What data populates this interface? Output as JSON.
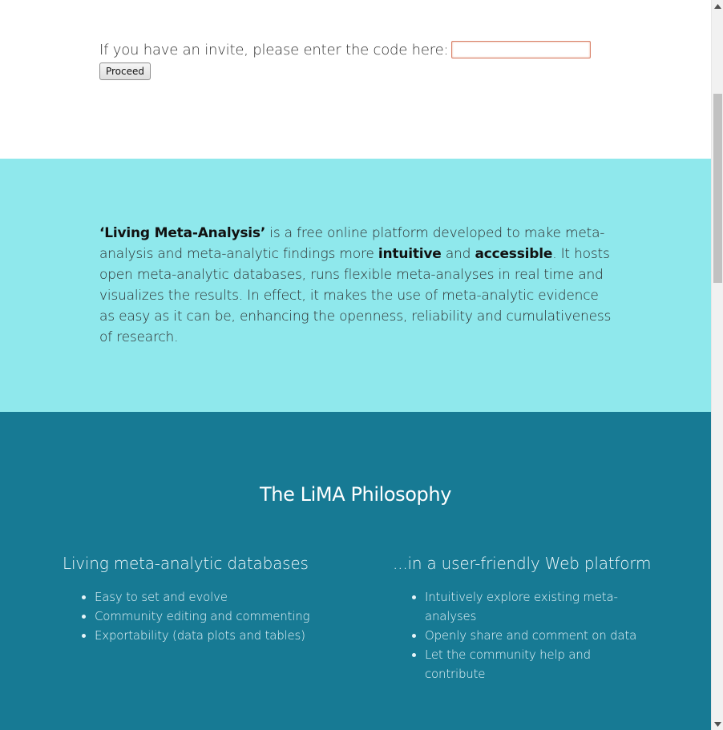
{
  "invite": {
    "label": "If you have an invite, please enter the code here:",
    "input_value": "",
    "proceed_label": "Proceed"
  },
  "intro": {
    "parts": [
      "‘Living Meta-Analysis’",
      " is a free online platform developed to make meta-analysis and meta-analytic findings more ",
      "intuitive",
      " and ",
      "accessible",
      ". It hosts open meta-analytic databases, runs flexible meta-analyses in real time and visualizes the results. In effect, it makes the use of meta-analytic evidence as easy as it can be, enhancing the openness, reliability and cumulativeness of research."
    ]
  },
  "philosophy": {
    "title": "The LiMA Philosophy",
    "left": {
      "heading": "Living meta-analytic databases",
      "items": [
        "Easy to set and evolve",
        "Community editing and commenting",
        "Exportability (data plots and tables)"
      ]
    },
    "right": {
      "heading": "...in a user-friendly Web platform",
      "items": [
        "Intuitively explore existing meta-analyses",
        "Openly share and comment on data",
        "Let the community help and contribute"
      ]
    }
  },
  "colors": {
    "intro_bg": "#8fe8ec",
    "philosophy_bg": "#177a94",
    "input_border": "#d9826a"
  },
  "icons": {
    "scroll_up": "triangle-up-icon",
    "scroll_down": "triangle-down-icon"
  }
}
